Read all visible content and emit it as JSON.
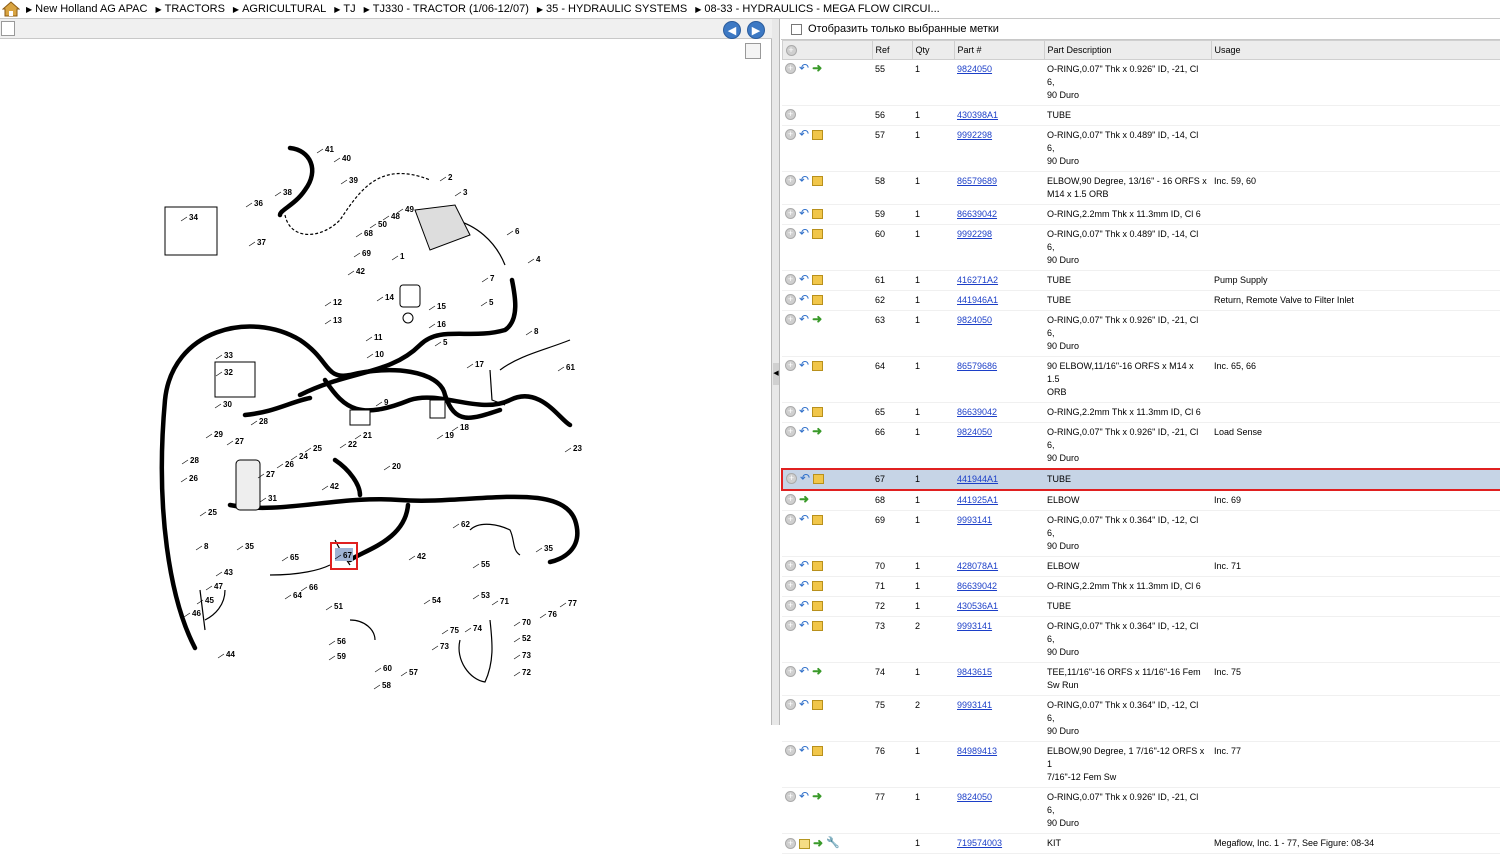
{
  "breadcrumb": [
    "New Holland AG APAC",
    "TRACTORS",
    "AGRICULTURAL",
    "TJ",
    "TJ330 - TRACTOR (1/06-12/07)",
    "35 - HYDRAULIC SYSTEMS",
    "08-33 - HYDRAULICS - MEGA FLOW CIRCUI..."
  ],
  "filter": {
    "label": "Отобразить только выбранные метки"
  },
  "columns": [
    "Ref",
    "Qty",
    "Part #",
    "Part Description",
    "Usage"
  ],
  "highlight_ref": "67",
  "diagram_labels": [
    "41",
    "40",
    "39",
    "38",
    "36",
    "37",
    "34",
    "2",
    "3",
    "6",
    "49",
    "48",
    "50",
    "68",
    "69",
    "1",
    "42",
    "4",
    "7",
    "14",
    "15",
    "5",
    "8",
    "12",
    "13",
    "11",
    "10",
    "16",
    "5",
    "17",
    "61",
    "33",
    "32",
    "30",
    "9",
    "28",
    "29",
    "27",
    "26",
    "24",
    "25",
    "22",
    "21",
    "20",
    "18",
    "19",
    "23",
    "28",
    "26",
    "27",
    "31",
    "25",
    "42",
    "35",
    "8",
    "67",
    "42",
    "65",
    "64",
    "66",
    "51",
    "62",
    "55",
    "53",
    "35",
    "43",
    "47",
    "45",
    "46",
    "44",
    "54",
    "71",
    "70",
    "76",
    "77",
    "56",
    "59",
    "60",
    "57",
    "58",
    "75",
    "74",
    "73",
    "52",
    "73",
    "72"
  ],
  "rows": [
    {
      "icons": [
        "plus",
        "back",
        "go"
      ],
      "ref": "55",
      "qty": "1",
      "part": "9824050",
      "desc": [
        "O-RING,0.07\" Thk x 0.926\" ID, -21, Cl 6,",
        "90 Duro"
      ],
      "usage": ""
    },
    {
      "icons": [
        "plus"
      ],
      "ref": "56",
      "qty": "1",
      "part": "430398A1",
      "desc": [
        "TUBE"
      ],
      "usage": ""
    },
    {
      "icons": [
        "plus",
        "back",
        "box"
      ],
      "ref": "57",
      "qty": "1",
      "part": "9992298",
      "desc": [
        "O-RING,0.07\" Thk x 0.489\" ID, -14, Cl 6,",
        "90 Duro"
      ],
      "usage": ""
    },
    {
      "icons": [
        "plus",
        "back",
        "box"
      ],
      "ref": "58",
      "qty": "1",
      "part": "86579689",
      "desc": [
        "ELBOW,90 Degree, 13/16\" - 16 ORFS x",
        "M14 x 1.5 ORB"
      ],
      "usage": "Inc. 59, 60"
    },
    {
      "icons": [
        "plus",
        "back",
        "box"
      ],
      "ref": "59",
      "qty": "1",
      "part": "86639042",
      "desc": [
        "O-RING,2.2mm Thk x 11.3mm ID, Cl 6"
      ],
      "usage": ""
    },
    {
      "icons": [
        "plus",
        "back",
        "box"
      ],
      "ref": "60",
      "qty": "1",
      "part": "9992298",
      "desc": [
        "O-RING,0.07\" Thk x 0.489\" ID, -14, Cl 6,",
        "90 Duro"
      ],
      "usage": ""
    },
    {
      "icons": [
        "plus",
        "back",
        "box"
      ],
      "ref": "61",
      "qty": "1",
      "part": "416271A2",
      "desc": [
        "TUBE"
      ],
      "usage": "Pump Supply"
    },
    {
      "icons": [
        "plus",
        "back",
        "box"
      ],
      "ref": "62",
      "qty": "1",
      "part": "441946A1",
      "desc": [
        "TUBE"
      ],
      "usage": "Return, Remote Valve to Filter Inlet"
    },
    {
      "icons": [
        "plus",
        "back",
        "go"
      ],
      "ref": "63",
      "qty": "1",
      "part": "9824050",
      "desc": [
        "O-RING,0.07\" Thk x 0.926\" ID, -21, Cl 6,",
        "90 Duro"
      ],
      "usage": ""
    },
    {
      "icons": [
        "plus",
        "back",
        "box"
      ],
      "ref": "64",
      "qty": "1",
      "part": "86579686",
      "desc": [
        "90 ELBOW,11/16\"-16 ORFS x M14 x 1.5",
        "ORB"
      ],
      "usage": "Inc. 65, 66"
    },
    {
      "icons": [
        "plus",
        "back",
        "box"
      ],
      "ref": "65",
      "qty": "1",
      "part": "86639042",
      "desc": [
        "O-RING,2.2mm Thk x 11.3mm ID, Cl 6"
      ],
      "usage": ""
    },
    {
      "icons": [
        "plus",
        "back",
        "go"
      ],
      "ref": "66",
      "qty": "1",
      "part": "9824050",
      "desc": [
        "O-RING,0.07\" Thk x 0.926\" ID, -21, Cl 6,",
        "90 Duro"
      ],
      "usage": "Load Sense"
    },
    {
      "icons": [
        "plus",
        "back",
        "box"
      ],
      "ref": "67",
      "qty": "1",
      "part": "441944A1",
      "desc": [
        "TUBE"
      ],
      "usage": ""
    },
    {
      "icons": [
        "plus",
        "go"
      ],
      "ref": "68",
      "qty": "1",
      "part": "441925A1",
      "desc": [
        "ELBOW"
      ],
      "usage": "Inc. 69"
    },
    {
      "icons": [
        "plus",
        "back",
        "box"
      ],
      "ref": "69",
      "qty": "1",
      "part": "9993141",
      "desc": [
        "O-RING,0.07\" Thk x 0.364\" ID, -12, Cl 6,",
        "90 Duro"
      ],
      "usage": ""
    },
    {
      "icons": [
        "plus",
        "back",
        "box"
      ],
      "ref": "70",
      "qty": "1",
      "part": "428078A1",
      "desc": [
        "ELBOW"
      ],
      "usage": "Inc. 71"
    },
    {
      "icons": [
        "plus",
        "back",
        "box"
      ],
      "ref": "71",
      "qty": "1",
      "part": "86639042",
      "desc": [
        "O-RING,2.2mm Thk x 11.3mm ID, Cl 6"
      ],
      "usage": ""
    },
    {
      "icons": [
        "plus",
        "back",
        "box"
      ],
      "ref": "72",
      "qty": "1",
      "part": "430536A1",
      "desc": [
        "TUBE"
      ],
      "usage": ""
    },
    {
      "icons": [
        "plus",
        "back",
        "box"
      ],
      "ref": "73",
      "qty": "2",
      "part": "9993141",
      "desc": [
        "O-RING,0.07\" Thk x 0.364\" ID, -12, Cl 6,",
        "90 Duro"
      ],
      "usage": ""
    },
    {
      "icons": [
        "plus",
        "back",
        "go"
      ],
      "ref": "74",
      "qty": "1",
      "part": "9843615",
      "desc": [
        "TEE,11/16\"-16 ORFS x 11/16\"-16 Fem",
        "Sw Run"
      ],
      "usage": "Inc. 75"
    },
    {
      "icons": [
        "plus",
        "back",
        "box"
      ],
      "ref": "75",
      "qty": "2",
      "part": "9993141",
      "desc": [
        "O-RING,0.07\" Thk x 0.364\" ID, -12, Cl 6,",
        "90 Duro"
      ],
      "usage": ""
    },
    {
      "icons": [
        "plus",
        "back",
        "box"
      ],
      "ref": "76",
      "qty": "1",
      "part": "84989413",
      "desc": [
        "ELBOW,90 Degree, 1 7/16\"-12 ORFS x 1",
        "7/16\"-12 Fem Sw"
      ],
      "usage": "Inc. 77"
    },
    {
      "icons": [
        "plus",
        "back",
        "go"
      ],
      "ref": "77",
      "qty": "1",
      "part": "9824050",
      "desc": [
        "O-RING,0.07\" Thk x 0.926\" ID, -21, Cl 6,",
        "90 Duro"
      ],
      "usage": ""
    },
    {
      "icons": [
        "plus",
        "book",
        "go",
        "wrench"
      ],
      "ref": "",
      "qty": "1",
      "part": "719574003",
      "desc": [
        "KIT"
      ],
      "usage": "Megaflow, Inc. 1 - 77, See Figure: 08-34"
    }
  ]
}
